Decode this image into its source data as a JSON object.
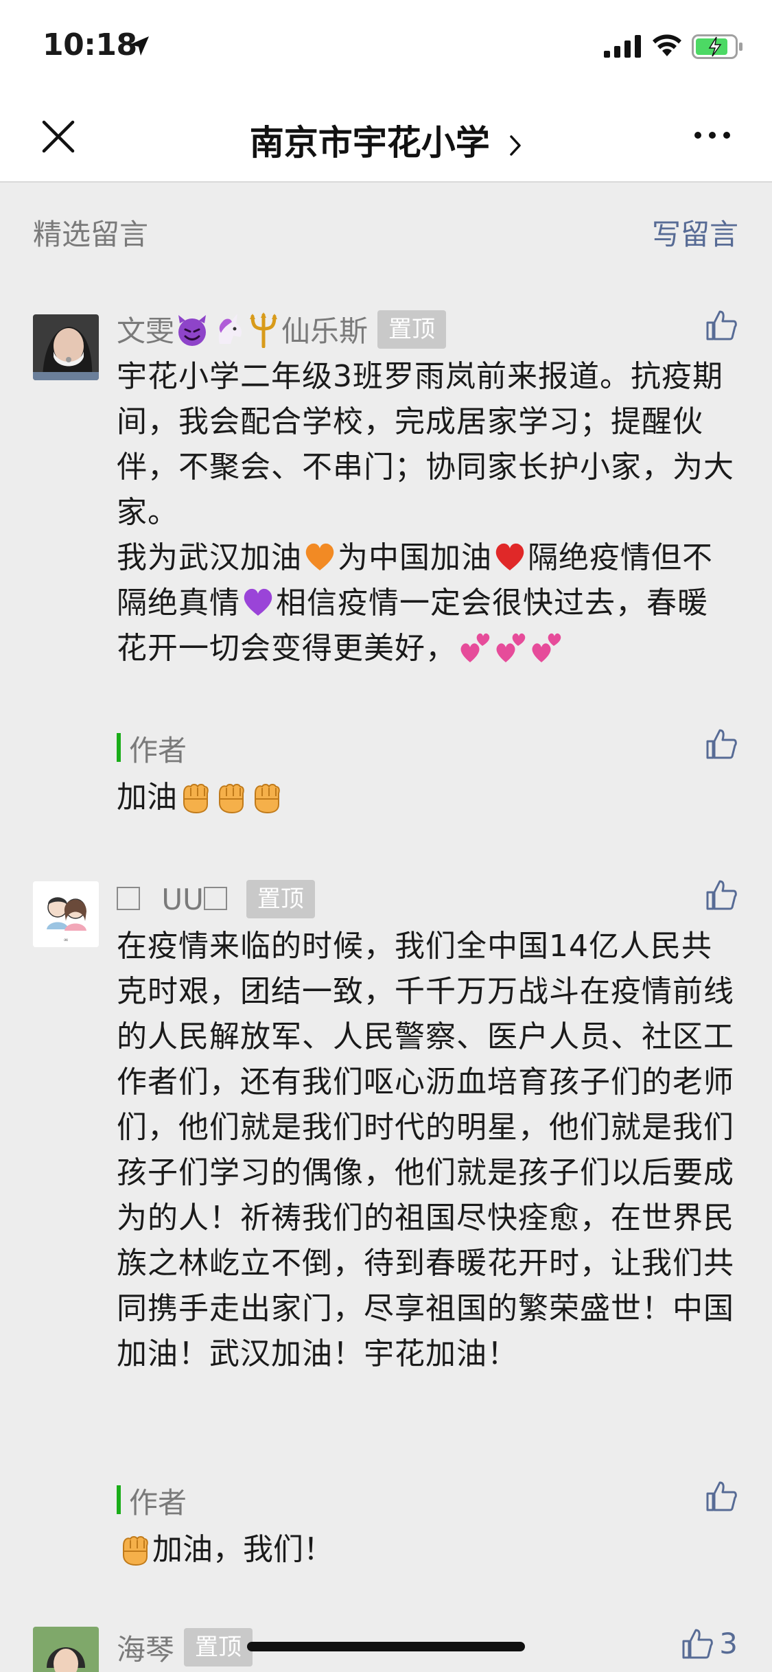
{
  "status_bar": {
    "time": "10:18"
  },
  "nav": {
    "title": "南京市宇花小学"
  },
  "comments_header": {
    "title": "精选留言",
    "write_label": "写留言"
  },
  "comments": [
    {
      "nickname_suffix": "仙乐斯",
      "nickname_prefix": "文雯",
      "pinned_label": "置顶",
      "body_p1": "宇花小学二年级3班罗雨岚前来报道。抗疫期间，我会配合学校，完成居家学习；提醒伙伴，不聚会、不串门；协同家长护小家，为大家。",
      "body_l1": "我为武汉加油",
      "body_l2": "为中国加油",
      "body_l3": "隔绝疫情但不隔绝真情",
      "body_l4": "相信疫情一定会很快过去，春暖花开一切会变得更美好，",
      "reply_author": "作者",
      "reply_text": "加油"
    },
    {
      "nickname": "UU",
      "pinned_label": "置顶",
      "body": "在疫情来临的时候，我们全中国14亿人民共克时艰，团结一致，千千万万战斗在疫情前线的人民解放军、人民警察、医户人员、社区工作者们，还有我们呕心沥血培育孩子们的老师们，他们就是我们时代的明星，他们就是我们孩子们学习的偶像，他们就是孩子们以后要成为的人！祈祷我们的祖国尽快痊愈，在世界民族之林屹立不倒，待到春暖花开时，让我们共同携手走出家门，尽享祖国的繁荣盛世！中国加油！武汉加油！宇花加油！",
      "reply_author": "作者",
      "reply_text": "加油，我们！"
    },
    {
      "nickname": "海琴",
      "pinned_label": "置顶",
      "like_count": "3"
    }
  ]
}
